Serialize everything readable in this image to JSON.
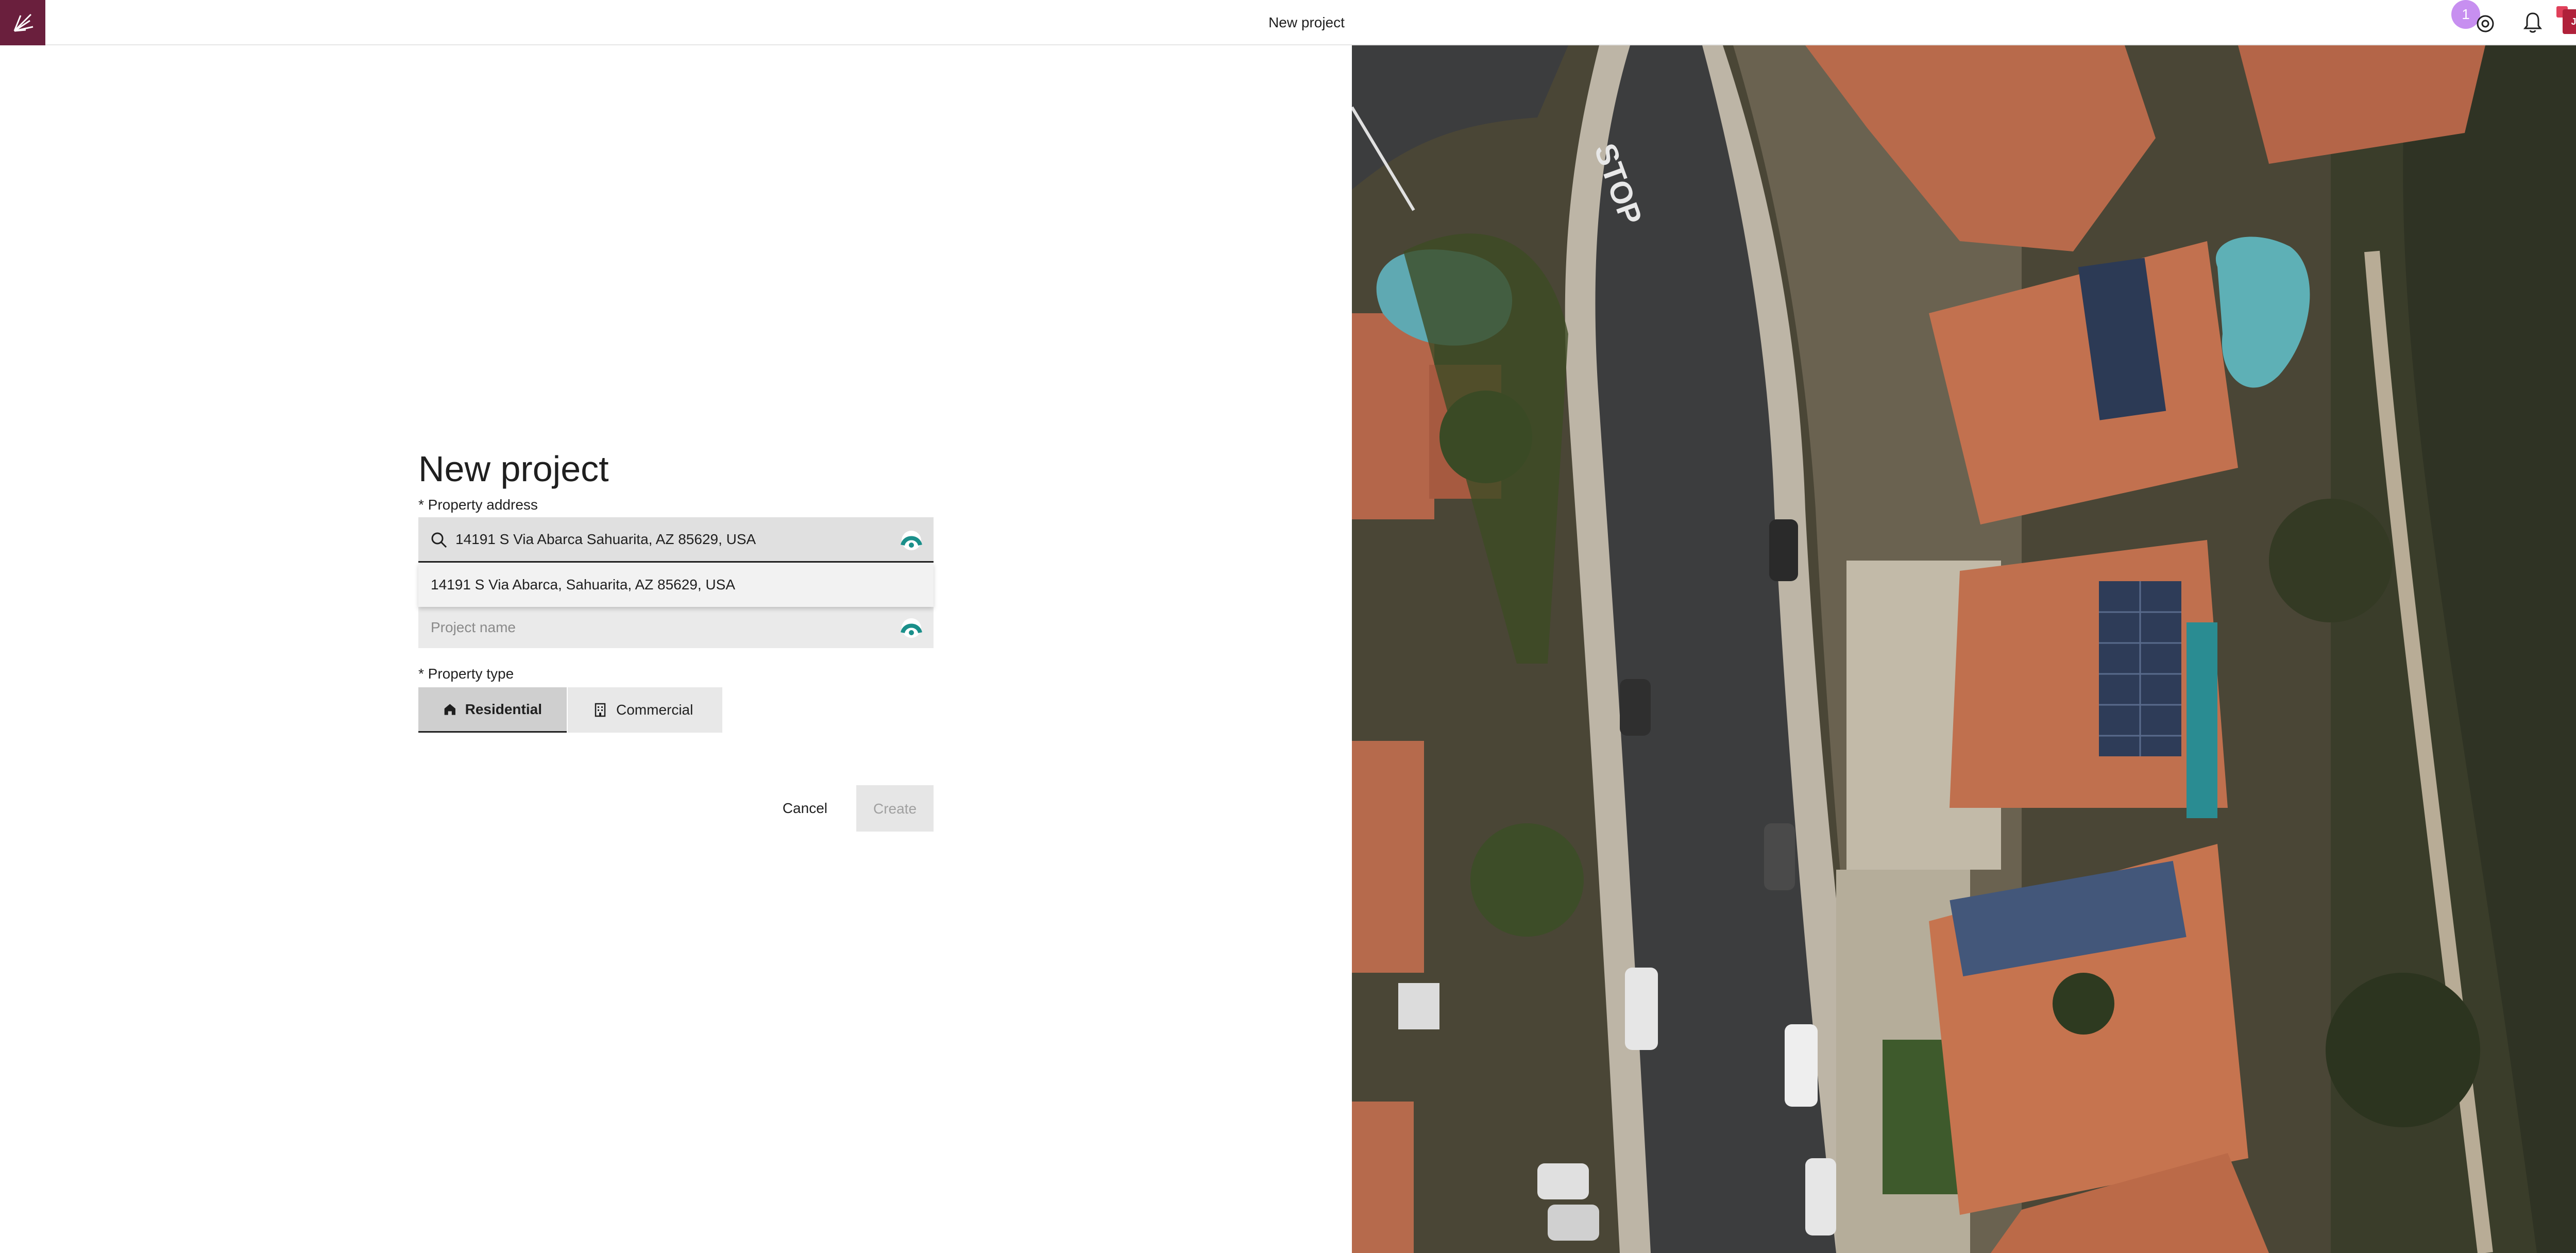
{
  "topbar": {
    "title": "New project",
    "notification_count": "1",
    "avatar_initials": "JI"
  },
  "form": {
    "heading": "New project",
    "address_label": "* Property address",
    "address_value": "14191 S Via Abarca Sahuarita, AZ 85629, USA",
    "suggestion": "14191 S Via Abarca, Sahuarita, AZ 85629, USA",
    "project_name_placeholder": "Project name",
    "property_type_label": "* Property type",
    "property_types": [
      "Residential",
      "Commercial"
    ],
    "selected_property_type": "Residential",
    "cancel_label": "Cancel",
    "create_label": "Create"
  },
  "colors": {
    "brand": "#6a1f3d",
    "badge": "#c78ff0",
    "avatar": "#b0213a"
  },
  "hero": {
    "road_marking": "STOP"
  }
}
